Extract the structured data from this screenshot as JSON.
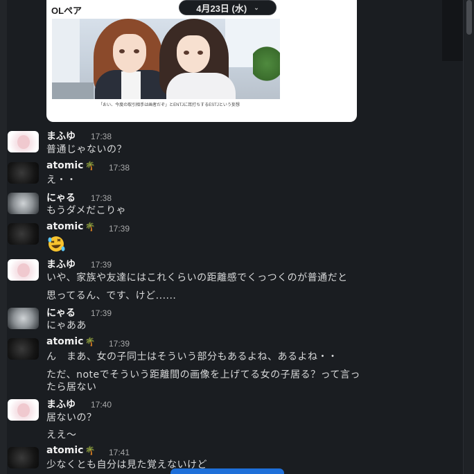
{
  "card": {
    "title": "OLペア",
    "caption": "「おい、今度の取引相手は画者だぞ」とENTJに耳打ちするESTJという妄想"
  },
  "date_divider": {
    "label": "4月23日 (水)",
    "icon": "chevron-down-icon"
  },
  "messages": [
    {
      "user": "まふゆ",
      "time": "17:38",
      "lines": [
        "普通じゃないの？"
      ]
    },
    {
      "user": "atomic",
      "emoji": "🌴",
      "time": "17:38",
      "lines": [
        "え・・"
      ]
    },
    {
      "user": "にゃる",
      "time": "17:38",
      "lines": [
        "もうダメだこりゃ"
      ]
    },
    {
      "user": "atomic",
      "emoji": "🌴",
      "time": "17:39",
      "lines": []
    },
    {
      "user": "まふゆ",
      "time": "17:39",
      "lines": [
        "いや、家族や友達にはこれくらいの距離感でくっつくのが普通だと",
        "思ってるん、です、けど......"
      ]
    },
    {
      "user": "にゃる",
      "time": "17:39",
      "lines": [
        "にゃああ"
      ]
    },
    {
      "user": "atomic",
      "emoji": "🌴",
      "time": "17:39",
      "lines": [
        "ん　まあ、女の子同士はそういう部分もあるよね、あるよね・・",
        "ただ、noteでそういう距離間の画像を上げてる女の子居る？って言っ",
        "たら居ない"
      ]
    },
    {
      "user": "まふゆ",
      "time": "17:40",
      "lines": [
        "居ないの？",
        "ええ〜"
      ]
    },
    {
      "user": "atomic",
      "emoji": "🌴",
      "time": "17:41",
      "lines": [
        "少なくとも自分は見た覚えないけど"
      ]
    }
  ]
}
